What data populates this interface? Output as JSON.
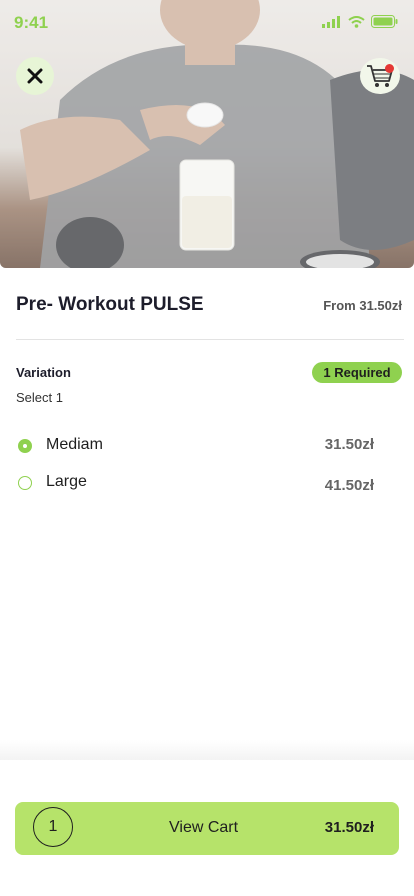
{
  "status_bar": {
    "time": "9:41"
  },
  "hero": {
    "image": "protein-shaker-photo"
  },
  "header": {
    "close_icon": "close-icon",
    "cart_icon": "cart-icon",
    "cart_badge": ""
  },
  "product": {
    "title": "Pre- Workout PULSE",
    "from_price": "From 31.50zł"
  },
  "variation": {
    "label": "Variation",
    "required_badge": "1 Required",
    "select_hint": "Select 1",
    "options": [
      {
        "label": "Mediam",
        "price": "31.50zł",
        "selected": true
      },
      {
        "label": "Large",
        "price": "41.50zł",
        "selected": false
      }
    ]
  },
  "cart_bar": {
    "quantity": "1",
    "label": "View Cart",
    "total": "31.50zł"
  },
  "colors": {
    "accent": "#8fd14f",
    "cart_bar": "#b6e36a",
    "badge_red": "#e53935"
  }
}
